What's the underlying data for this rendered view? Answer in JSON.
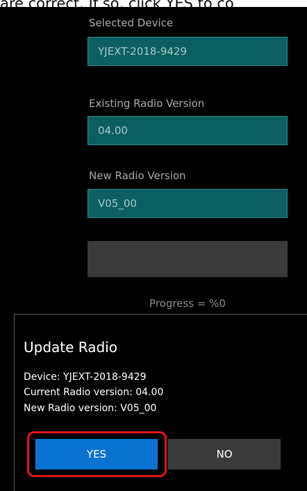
{
  "instruction_text": "are correct. If so, click YES to co",
  "form": {
    "selected_device": {
      "label": "Selected Device",
      "value": "YJEXT-2018-9429"
    },
    "existing_radio_version": {
      "label": "Existing Radio Version",
      "value": "04.00"
    },
    "new_radio_version": {
      "label": "New Radio Version",
      "value": "V05_00"
    }
  },
  "progress": {
    "label": "Progress = %0",
    "value_percent": 0
  },
  "dialog": {
    "title": "Update Radio",
    "device_line": "Device: YJEXT-2018-9429",
    "current_version_line": "Current Radio version: 04.00",
    "new_version_line": "New Radio version: V05_00",
    "yes_label": "YES",
    "no_label": "NO"
  },
  "colors": {
    "field_background": "#0c5f61",
    "field_border": "#2a8a8c",
    "yes_button": "#0a73d1",
    "no_button": "#3a3a3a",
    "highlight": "#e4121c",
    "panel_background": "#000000"
  }
}
